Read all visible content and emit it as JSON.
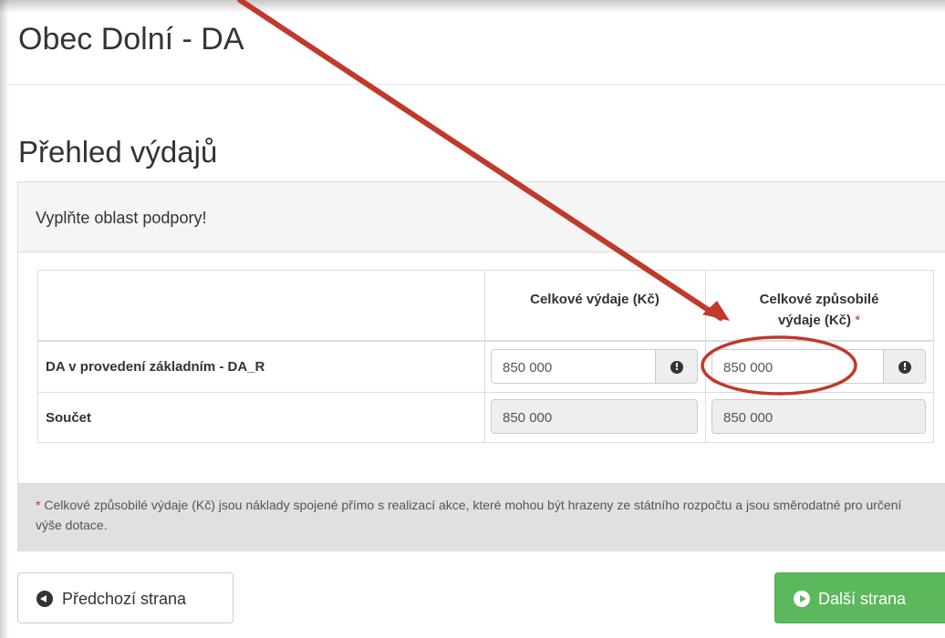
{
  "header": {
    "title": "Obec Dolní - DA"
  },
  "page": {
    "title": "Přehled výdajů"
  },
  "panel": {
    "heading": "Vyplňte oblast podpory!",
    "table": {
      "columns": [
        "Celkové výdaje (Kč)",
        "Celkové způsobilé",
        "výdaje (Kč)"
      ],
      "required_mark": "*",
      "rows": [
        {
          "label": "DA v provedení základním - DA_R",
          "total": "850 000",
          "eligible": "850 000"
        },
        {
          "label": "Součet",
          "total": "850 000",
          "eligible": "850 000"
        }
      ]
    },
    "footer": {
      "required_mark": "*",
      "note": "Celkové způsobilé výdaje (Kč) jsou náklady spojené přímo s realizací akce, které mohou být hrazeny ze státního rozpočtu a jsou směrodatné pro určení výše dotace."
    }
  },
  "buttons": {
    "prev": "Předchozí strana",
    "next": "Další strana"
  },
  "icons": {
    "info": "info-icon",
    "prev": "circle-arrow-left-icon",
    "next": "circle-arrow-right-icon"
  },
  "colors": {
    "success": "#5cb85c",
    "required": "#c9302c",
    "annotation": "#c0392b"
  }
}
